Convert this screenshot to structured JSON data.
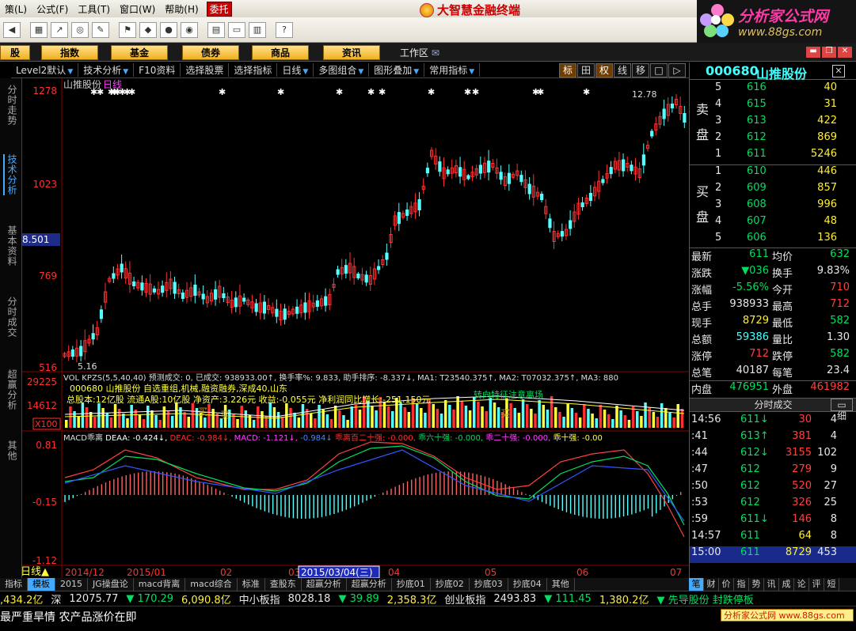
{
  "menu": {
    "items": [
      "策(L)",
      "公式(F)",
      "工具(T)",
      "窗口(W)",
      "帮助(H)"
    ],
    "entrust": "委托"
  },
  "brand": "大智慧金融终端",
  "watermark": {
    "title": "分析家公式网",
    "url": "www.88gs.com"
  },
  "categories": [
    "股",
    "指数",
    "基金",
    "债券",
    "商品",
    "资讯"
  ],
  "workarea": "工作区",
  "subbar": {
    "items": [
      "Level2默认",
      "技术分析",
      "F10资料",
      "选择股票",
      "选择指标",
      "日线",
      "多图组合",
      "图形叠加",
      "常用指标"
    ]
  },
  "right_tabs": [
    "标",
    "田",
    "权",
    "线",
    "移",
    "□",
    "▷"
  ],
  "left_nav": [
    "分时走势",
    "技术分析",
    "基本资料",
    "分时成交",
    "超赢分析",
    "其他"
  ],
  "chart": {
    "stock_label": "山推股份",
    "period_label": "日线",
    "y_ticks": [
      "1278",
      "1023",
      "769",
      "516"
    ],
    "current_price": "8.501",
    "high_label": "12.78",
    "low_label": "5.16",
    "vol_header": "VOL KPZS(5,5,40,40)  预测成交: 0, 已成交: 938933.00↑, 换手率%: 9.833, 助手排序: -8.337↓, MA1: T23540.375↑, MA2: T07032.375↑, MA3: 880",
    "vol_ticks": [
      "29225",
      "14612",
      "X100"
    ],
    "vol_info1": "000680 山推股份 自选重组,机械,融资融券,深成40,山东",
    "vol_info2": "总股本:12亿股 流通A股:10亿股  净资产:3.226元  收益:-0.055元  净利润同比增长:-251.150元",
    "vol_note": "转向特征注意离场",
    "vol_buy": [
      "买",
      "买",
      "买"
    ],
    "macd_header_parts": [
      {
        "text": "MACD乖离 ",
        "color": "#ddd"
      },
      {
        "text": "DEAA: -0.424↓, ",
        "color": "#ffffff"
      },
      {
        "text": "DEAC: -0.984↓, ",
        "color": "#ff3030"
      },
      {
        "text": "MACD: -1.121↓, ",
        "color": "#ff40ff"
      },
      {
        "text": "-0.984↓ ",
        "color": "#4488ff"
      },
      {
        "text": "乖离百二十强: -0.000, ",
        "color": "#ff3030"
      },
      {
        "text": "乖六十强: -0.000, ",
        "color": "#00e060"
      },
      {
        "text": "乖二十强: -0.000, ",
        "color": "#ff40ff"
      },
      {
        "text": "乖十强: -0.00",
        "color": "#ffff40"
      }
    ],
    "macd_ticks": [
      "0.81",
      "-0.15",
      "-1.12"
    ],
    "x_labels": [
      "2014/12",
      "2015/01",
      "02",
      "03",
      "04",
      "05",
      "06",
      "07"
    ],
    "date_cursor": "2015/03/04(三)",
    "period_tag": "日线▲"
  },
  "quote": {
    "code": "000680",
    "name": "山推股份",
    "sell_label": [
      "卖",
      "盘"
    ],
    "buy_label": [
      "买",
      "盘"
    ],
    "sells": [
      {
        "lv": "5",
        "price": "616",
        "vol": "40"
      },
      {
        "lv": "4",
        "price": "615",
        "vol": "31"
      },
      {
        "lv": "3",
        "price": "613",
        "vol": "422"
      },
      {
        "lv": "2",
        "price": "612",
        "vol": "869"
      },
      {
        "lv": "1",
        "price": "611",
        "vol": "5246"
      }
    ],
    "buys": [
      {
        "lv": "1",
        "price": "610",
        "vol": "446"
      },
      {
        "lv": "2",
        "price": "609",
        "vol": "857"
      },
      {
        "lv": "3",
        "price": "608",
        "vol": "996"
      },
      {
        "lv": "4",
        "price": "607",
        "vol": "48"
      },
      {
        "lv": "5",
        "price": "606",
        "vol": "136"
      }
    ],
    "stats": [
      {
        "k1": "最新",
        "v1": "611",
        "k2": "均价",
        "v2": "632",
        "c1": "g",
        "c2": "g"
      },
      {
        "k1": "涨跌",
        "v1": "▼036",
        "k2": "换手",
        "v2": "9.83%",
        "c1": "g",
        "c2": "w"
      },
      {
        "k1": "涨幅",
        "v1": "-5.56%",
        "k2": "今开",
        "v2": "710",
        "c1": "g",
        "c2": "r"
      },
      {
        "k1": "总手",
        "v1": "938933",
        "k2": "最高",
        "v2": "712",
        "c1": "w",
        "c2": "r"
      },
      {
        "k1": "现手",
        "v1": "8729",
        "k2": "最低",
        "v2": "582",
        "c1": "y",
        "c2": "g"
      },
      {
        "k1": "总额",
        "v1": "59386",
        "k2": "量比",
        "v2": "1.30",
        "c1": "c",
        "c2": "w"
      },
      {
        "k1": "涨停",
        "v1": "712",
        "k2": "跌停",
        "v2": "582",
        "c1": "r",
        "c2": "g"
      },
      {
        "k1": "总笔",
        "v1": "40187",
        "k2": "每笔",
        "v2": "23.4",
        "c1": "w",
        "c2": "w"
      }
    ],
    "inner_label": "内盘",
    "inner": "476951",
    "outer_label": "外盘",
    "outer": "461982",
    "ticks_title": "分时成交",
    "ticks": [
      {
        "t": "14:56",
        "p": "611↓",
        "v": "30",
        "n": "4",
        "pc": "g",
        "vc": "r"
      },
      {
        "t": ":41",
        "p": "613↑",
        "v": "381",
        "n": "4",
        "pc": "g",
        "vc": "r"
      },
      {
        "t": ":44",
        "p": "612↓",
        "v": "3155",
        "n": "102",
        "pc": "g",
        "vc": "r"
      },
      {
        "t": ":47",
        "p": "612",
        "v": "279",
        "n": "9",
        "pc": "g",
        "vc": "r"
      },
      {
        "t": ":50",
        "p": "612",
        "v": "520",
        "n": "27",
        "pc": "g",
        "vc": "r"
      },
      {
        "t": ":53",
        "p": "612",
        "v": "326",
        "n": "25",
        "pc": "g",
        "vc": "r"
      },
      {
        "t": ":59",
        "p": "611↓",
        "v": "146",
        "n": "8",
        "pc": "g",
        "vc": "r"
      },
      {
        "t": "14:57",
        "p": "611",
        "v": "64",
        "n": "8",
        "pc": "g",
        "vc": "y"
      },
      {
        "t": "15:00",
        "p": "611",
        "v": "8729",
        "n": "453",
        "pc": "g",
        "vc": "y"
      }
    ]
  },
  "bottom_tabs": [
    "指标",
    "模板",
    "2015",
    "JG操盘论",
    "macd背离",
    "macd综合",
    "标准",
    "查股东",
    "超赢分析",
    "超赢分析",
    "抄底01",
    "抄底02",
    "抄底03",
    "抄底04",
    "其他"
  ],
  "side_tabs": [
    "笔",
    "财",
    "价",
    "指",
    "势",
    "讯",
    "成",
    "论",
    "评",
    "短"
  ],
  "ticker": [
    {
      "t": ",434.2亿",
      "c": "y"
    },
    {
      "t": "深",
      "c": "w"
    },
    {
      "t": "12075.77",
      "c": "w"
    },
    {
      "t": "▼ 170.29",
      "c": "g"
    },
    {
      "t": "6,090.8亿",
      "c": "y"
    },
    {
      "t": "中小板指",
      "c": "w"
    },
    {
      "t": "8028.18",
      "c": "w"
    },
    {
      "t": "▼ 39.89",
      "c": "g"
    },
    {
      "t": "2,358.3亿",
      "c": "y"
    },
    {
      "t": "创业板指",
      "c": "w"
    },
    {
      "t": "2493.83",
      "c": "w"
    },
    {
      "t": "▼ 111.45",
      "c": "g"
    },
    {
      "t": "1,380.2亿",
      "c": "y"
    },
    {
      "t": "▼ 先导股份 封跌停板",
      "c": "g"
    }
  ],
  "news": "最严重旱情 农产品涨价在即",
  "bottom_watermark": "分析家公式网 www.88gs.com"
}
